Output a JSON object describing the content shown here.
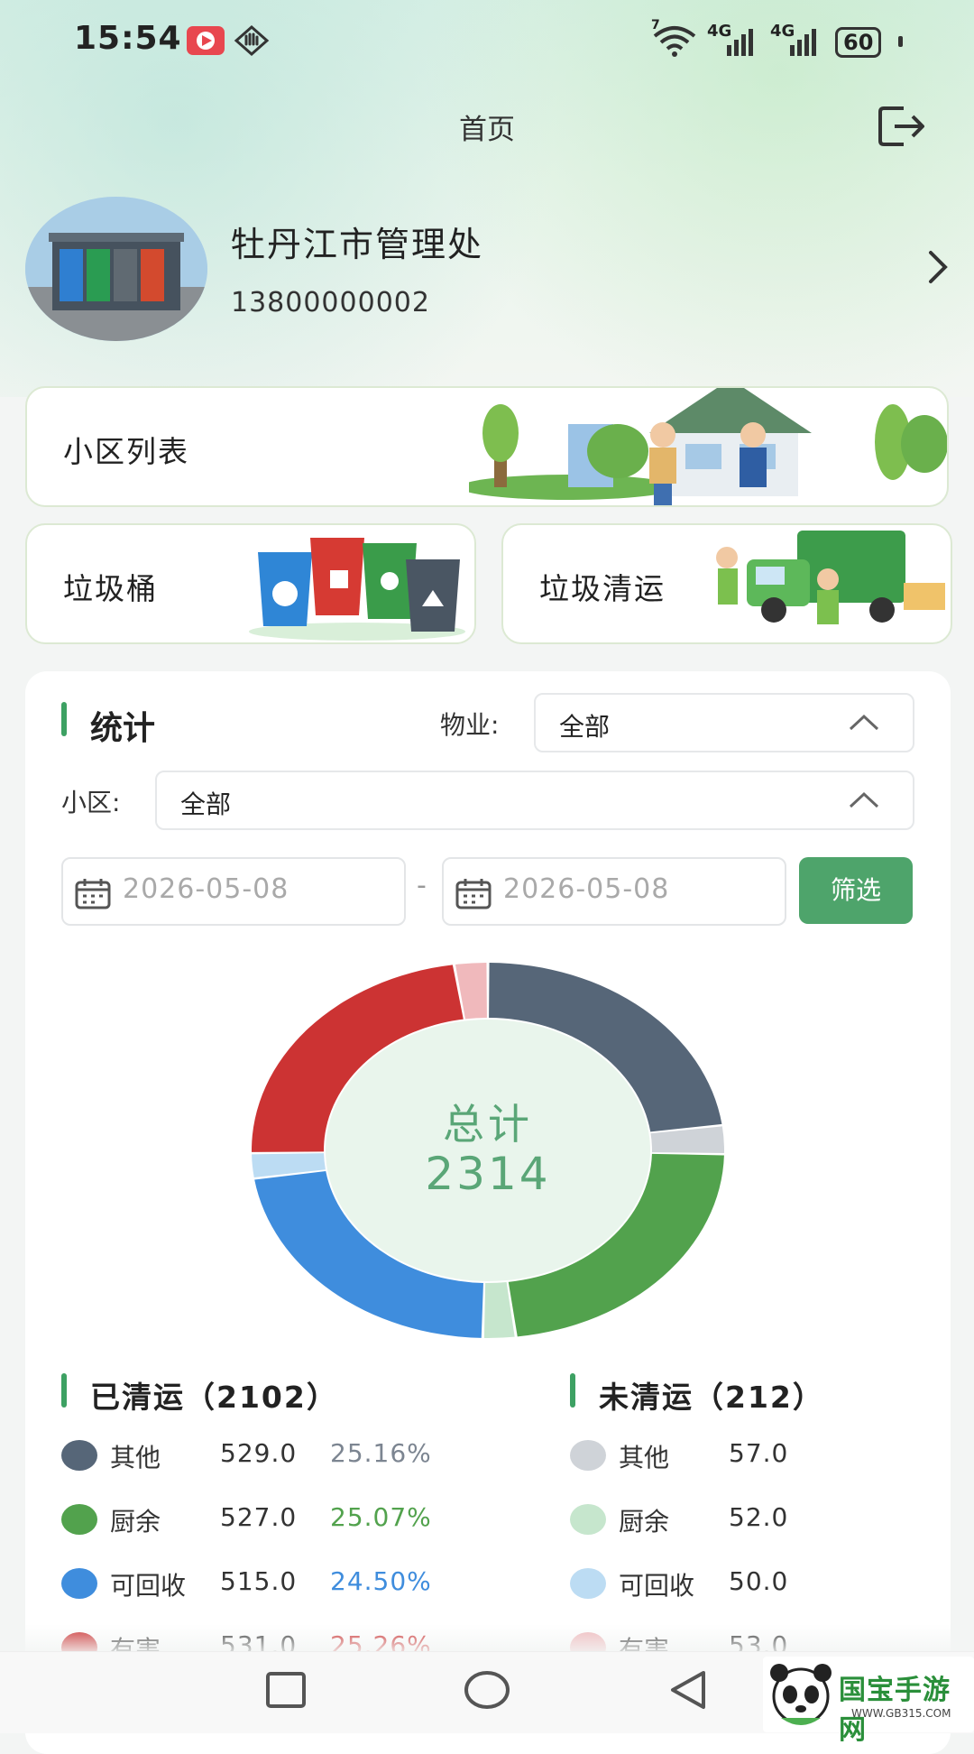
{
  "status_bar": {
    "time": "15:54",
    "battery": "60",
    "network_1": "4G",
    "network_2": "4G",
    "wifi_sup": "7",
    "icons": [
      "video-app-icon",
      "hand-icon",
      "wifi-icon",
      "signal-icon",
      "battery-icon"
    ]
  },
  "header": {
    "title": "首页",
    "logout_icon": "logout-icon"
  },
  "profile": {
    "name": "牡丹江市管理处",
    "phone": "13800000002"
  },
  "cards": {
    "community_list": "小区列表",
    "bins": "垃圾桶",
    "garbage_transport": "垃圾清运"
  },
  "stats": {
    "title": "统计",
    "property_label": "物业:",
    "property_value": "全部",
    "community_label": "小区:",
    "community_value": "全部",
    "date_start": "2026-05-08",
    "date_sep": "-",
    "date_end": "2026-05-08",
    "filter_button": "筛选"
  },
  "chart_data": {
    "type": "pie",
    "donut": true,
    "center_label": "总计",
    "center_value": "2314",
    "categories": [
      "其他(已清运)",
      "其他(未清运)",
      "厨余(已清运)",
      "厨余(未清运)",
      "可回收(已清运)",
      "可回收(未清运)",
      "有害(已清运)",
      "有害(未清运)"
    ],
    "values": [
      529,
      57,
      527,
      52,
      515,
      50,
      531,
      53
    ],
    "colors": [
      "#566678",
      "#cfd3d8",
      "#52a24d",
      "#c6e6cd",
      "#3f8ddd",
      "#bcdcf3",
      "#cc3333",
      "#f0b9bc"
    ]
  },
  "cleared": {
    "title": "已清运（2102）",
    "items": [
      {
        "name": "其他",
        "value": "529.0",
        "pct": "25.16%",
        "color": "#566678",
        "pct_color": "#7c8591"
      },
      {
        "name": "厨余",
        "value": "527.0",
        "pct": "25.07%",
        "color": "#52a24d",
        "pct_color": "#52a24d"
      },
      {
        "name": "可回收",
        "value": "515.0",
        "pct": "24.50%",
        "color": "#3f8ddd",
        "pct_color": "#3f8ddd"
      },
      {
        "name": "有害",
        "value": "531.0",
        "pct": "25.26%",
        "color": "#cc3333",
        "pct_color": "#cc3333"
      }
    ]
  },
  "uncleared": {
    "title": "未清运（212）",
    "items": [
      {
        "name": "其他",
        "value": "57.0",
        "color": "#cfd3d8"
      },
      {
        "name": "厨余",
        "value": "52.0",
        "color": "#c6e6cd"
      },
      {
        "name": "可回收",
        "value": "50.0",
        "color": "#bcdcf3"
      },
      {
        "name": "有害",
        "value": "53.0",
        "color": "#f0b9bc"
      }
    ]
  },
  "navbar": {
    "icons": [
      "recents-icon",
      "home-icon",
      "back-icon"
    ]
  },
  "watermark": {
    "text": "国宝手游网",
    "url": "WWW.GB315.COM"
  }
}
